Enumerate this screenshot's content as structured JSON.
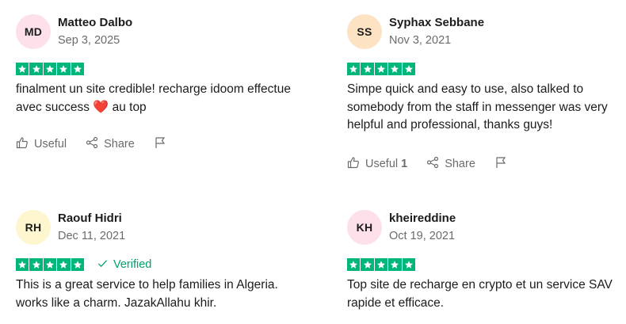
{
  "colors": {
    "star_green": "#00b67a",
    "verified_green": "#00a16b",
    "text_muted": "#6b6b6b"
  },
  "icons": {
    "useful": "thumbs-up-icon",
    "share": "share-icon",
    "report": "flag-icon",
    "verified": "check-icon",
    "star": "star-icon"
  },
  "labels": {
    "useful": "Useful",
    "share": "Share",
    "verified": "Verified"
  },
  "reviews": [
    {
      "initials": "MD",
      "avatar_color": "#fde0ea",
      "name": "Matteo Dalbo",
      "date": "Sep 3, 2025",
      "stars": 5,
      "verified": false,
      "text": "finalment un site credible! recharge idoom effectue avec success",
      "emoji": "❤️",
      "text_after": " au top",
      "useful_count": ""
    },
    {
      "initials": "SS",
      "avatar_color": "#fde2c4",
      "name": "Syphax Sebbane",
      "date": "Nov 3, 2021",
      "stars": 5,
      "verified": false,
      "text": "Simpe quick and easy to use, also talked to somebody from the staff in messenger was very helpful and professional, thanks guys!",
      "useful_count": "1"
    },
    {
      "initials": "RH",
      "avatar_color": "#fdf6cf",
      "name": "Raouf Hidri",
      "date": "Dec 11, 2021",
      "stars": 5,
      "verified": true,
      "text": "This is a great service to help families in Algeria. works like a charm. JazakAllahu khir."
    },
    {
      "initials": "KH",
      "avatar_color": "#fde0ea",
      "name": "kheireddine",
      "date": "Oct 19, 2021",
      "stars": 5,
      "verified": false,
      "text": "Top site de recharge en crypto et un service SAV rapide et efficace."
    }
  ]
}
